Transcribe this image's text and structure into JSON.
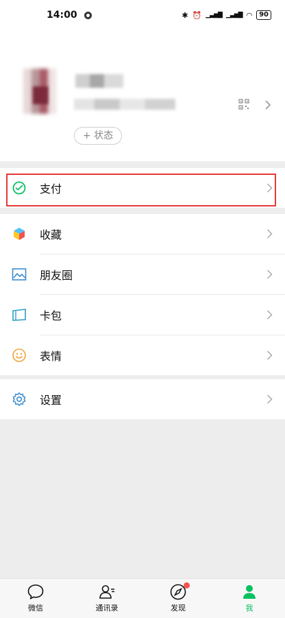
{
  "status_bar": {
    "time": "14:00",
    "battery": "90"
  },
  "profile": {
    "status_button": "+ 状态"
  },
  "menu": {
    "pay": "支付",
    "favorites": "收藏",
    "moments": "朋友圈",
    "cards": "卡包",
    "stickers": "表情",
    "settings": "设置"
  },
  "tabs": [
    {
      "label": "微信"
    },
    {
      "label": "通讯录"
    },
    {
      "label": "发现"
    },
    {
      "label": "我"
    }
  ],
  "colors": {
    "accent": "#07c160",
    "highlight": "#e53935",
    "badge": "#fa5151"
  }
}
